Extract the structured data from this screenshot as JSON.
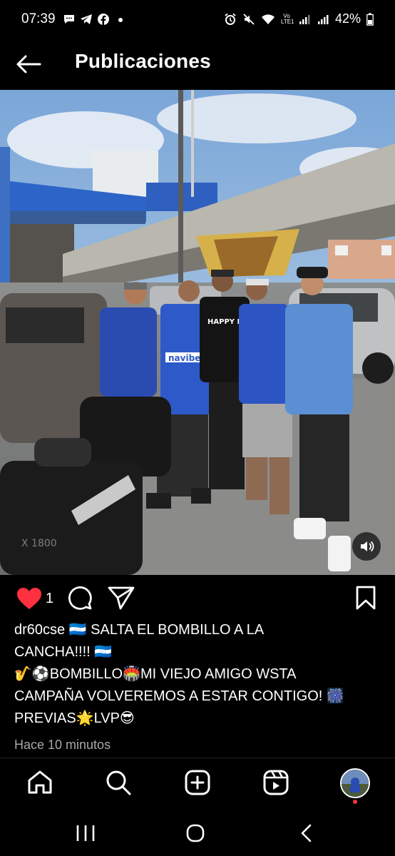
{
  "status_bar": {
    "time": "07:39",
    "left_icons": [
      "chat-bubble-icon",
      "telegram-icon",
      "facebook-icon",
      "dot-icon"
    ],
    "right_icons": [
      "alarm-icon",
      "mute-icon",
      "wifi-icon",
      "volte-icon",
      "signal-icon",
      "signal-icon"
    ],
    "volte_label": "Vo LTE1",
    "battery": "42%"
  },
  "header": {
    "title": "Publicaciones",
    "back_icon": "arrow-left-icon"
  },
  "post": {
    "photo_text": {
      "shirt_brand": "navibet",
      "shirt_slogan": "HAPPY MOMENT",
      "moto_text": "X 1800"
    },
    "like_count": "1",
    "caption_lines": [
      "dr60cse 🇭🇳 SALTA EL BOMBILLO A LA",
      "CANCHA!!!! 🇭🇳",
      "🎷⚽BOMBILLO🏟️MI VIEJO AMIGO WSTA",
      "CAMPAÑA VOLVEREMOS A ESTAR CONTIGO! 🎆",
      "PREVIAS🌟LVP😎"
    ],
    "time_ago": "Hace 10 minutos"
  },
  "bottom_nav": {
    "items": [
      "home-icon",
      "search-icon",
      "create-icon",
      "reels-icon",
      "profile-avatar"
    ]
  },
  "system_nav": {
    "items": [
      "recents-icon",
      "home-circle-icon",
      "back-chevron-icon"
    ]
  },
  "colors": {
    "background": "#000000",
    "like_red": "#ff3040",
    "secondary_text": "#a8a8a8"
  }
}
